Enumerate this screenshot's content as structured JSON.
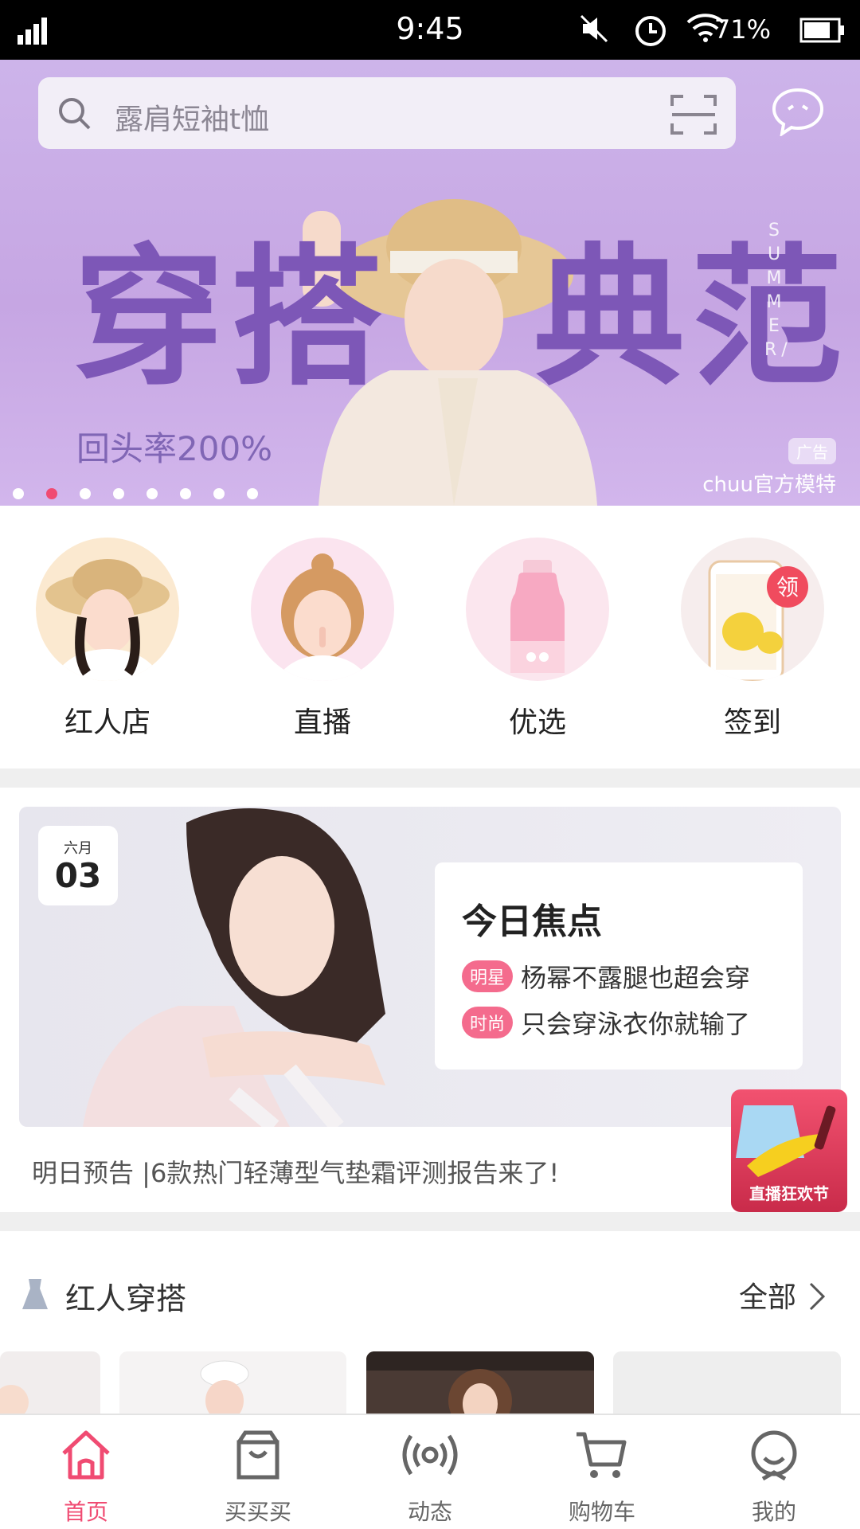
{
  "status_bar": {
    "time": "9:45",
    "battery": "71%"
  },
  "banner": {
    "search_placeholder": "露肩短袖t恤",
    "headline_left": "穿搭",
    "headline_right": "典范",
    "subline": "回头率200%",
    "vertical_text": "SUMMER/",
    "ad_tag": "广告",
    "credit": "chuu官方模特",
    "dot_count": 8,
    "active_dot": 1
  },
  "categories": [
    {
      "label": "红人店"
    },
    {
      "label": "直播"
    },
    {
      "label": "优选"
    },
    {
      "label": "签到",
      "badge": "领"
    }
  ],
  "focus": {
    "month": "六月",
    "day": "03",
    "title": "今日焦点",
    "items": [
      {
        "tag": "明星",
        "text": "杨幂不露腿也超会穿"
      },
      {
        "tag": "时尚",
        "text": "只会穿泳衣你就输了"
      }
    ],
    "preview": "明日预告 |6款热门轻薄型气垫霜评测报告来了!",
    "live_badge": "直播狂欢节"
  },
  "section": {
    "title": "红人穿搭",
    "all_label": "全部"
  },
  "tabs": [
    {
      "label": "首页",
      "icon": "home-icon",
      "active": true
    },
    {
      "label": "买买买",
      "icon": "shopping-bag-icon",
      "active": false
    },
    {
      "label": "动态",
      "icon": "broadcast-icon",
      "active": false
    },
    {
      "label": "购物车",
      "icon": "cart-icon",
      "active": false
    },
    {
      "label": "我的",
      "icon": "profile-icon",
      "active": false
    }
  ],
  "colors": {
    "accent": "#f04b72",
    "banner_purple": "#7d57b7",
    "tag_pink": "#f46b8d"
  }
}
